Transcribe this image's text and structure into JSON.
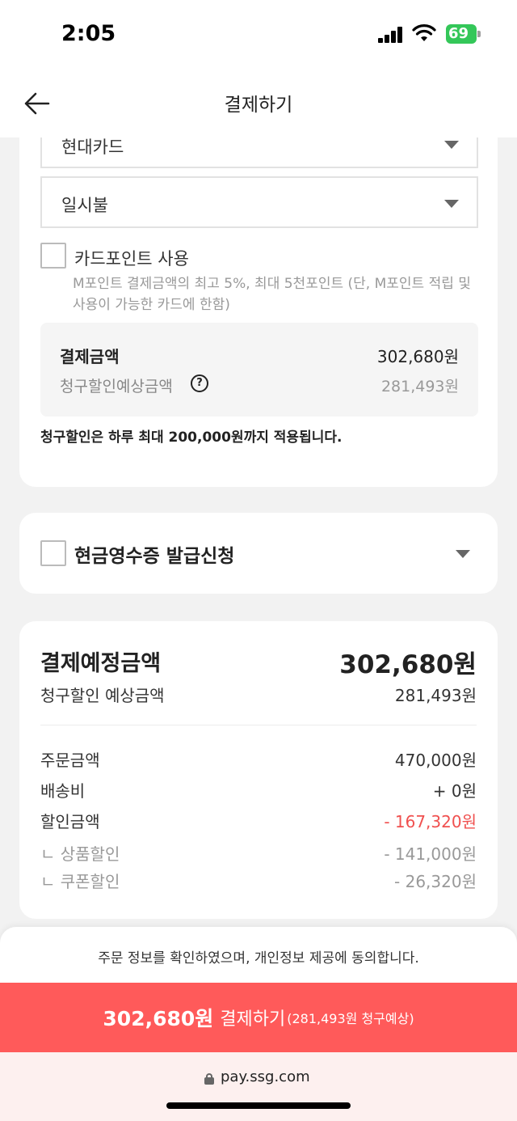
{
  "status_bar": {
    "time": "2:05",
    "battery": "69"
  },
  "header": {
    "title": "결제하기",
    "back_icon": "arrow-left-icon"
  },
  "card_section": {
    "card_company": "현대카드",
    "installment": "일시불",
    "point_use_label": "카드포인트 사용",
    "point_use_checked": false,
    "point_description": "M포인트 결제금액의 최고 5%, 최대 5천포인트 (단, M포인트 적립 및 사용이 가능한 카드에 한함)",
    "payment_amount_label": "결제금액",
    "payment_amount_value": "302,680원",
    "billing_discount_label": "청구할인예상금액",
    "billing_discount_value": "281,493원",
    "help_icon_glyph": "?",
    "limit_note": "청구할인은 하루 최대 200,000원까지 적용됩니다."
  },
  "cash_receipt": {
    "label": "현금영수증 발급신청",
    "checked": false
  },
  "summary": {
    "title": "결제예정금액",
    "total": "302,680원",
    "billing_discount_label": "청구할인 예상금액",
    "billing_discount_value": "281,493원",
    "rows": [
      {
        "label": "주문금액",
        "value": "470,000원"
      },
      {
        "label": "배송비",
        "value": "+ 0원"
      },
      {
        "label": "할인금액",
        "value": "- 167,320원"
      },
      {
        "label": "ㄴ 상품할인",
        "value": "- 141,000원"
      },
      {
        "label": "ㄴ 쿠폰할인",
        "value": "- 26,320원"
      }
    ]
  },
  "bottom": {
    "agreement": "주문 정보를 확인하였으며, 개인정보 제공에 동의합니다.",
    "pay_amount": "302,680원",
    "pay_label": "결제하기",
    "pay_note": "(281,493원 청구예상)",
    "url": "pay.ssg.com"
  },
  "colors": {
    "accent": "#ff5a5a",
    "discount": "#f0504f",
    "background": "#f2f2f2"
  }
}
